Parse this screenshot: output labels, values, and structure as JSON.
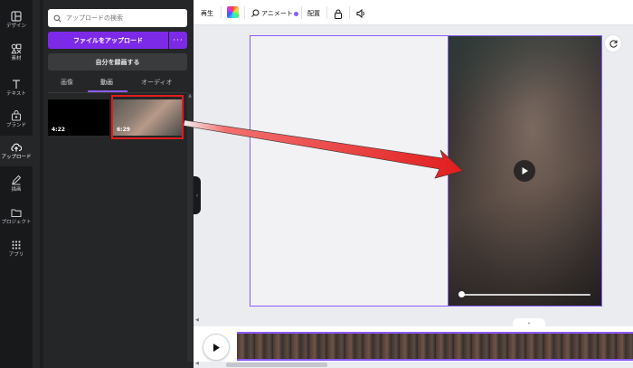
{
  "rail": {
    "items": [
      {
        "label": "デザイン",
        "icon": "layout-icon"
      },
      {
        "label": "素材",
        "icon": "elements-icon"
      },
      {
        "label": "テキスト",
        "icon": "text-icon"
      },
      {
        "label": "ブランド",
        "icon": "brand-icon"
      },
      {
        "label": "アップロード",
        "icon": "cloud-upload-icon"
      },
      {
        "label": "描画",
        "icon": "draw-icon"
      },
      {
        "label": "プロジェクト",
        "icon": "folder-icon"
      },
      {
        "label": "アプリ",
        "icon": "apps-icon"
      }
    ]
  },
  "panel": {
    "search_placeholder": "アップロードの検索",
    "upload_label": "ファイルをアップロード",
    "more_label": "···",
    "record_label": "自分を録画する",
    "tabs": [
      {
        "label": "画像"
      },
      {
        "label": "動画"
      },
      {
        "label": "オーディオ"
      }
    ],
    "active_tab": "動画",
    "thumbnails": [
      {
        "duration": "4:22"
      },
      {
        "duration": "6:29"
      }
    ]
  },
  "toolbar": {
    "play_label": "再生",
    "animate_label": "アニメート",
    "position_label": "配置"
  },
  "colors": {
    "accent": "#8b5cf6",
    "upload_button": "#7d2ae8",
    "highlight_box": "#e11d1d",
    "annotation_arrow": "#e11d1d"
  },
  "video": {
    "progress": 0
  }
}
